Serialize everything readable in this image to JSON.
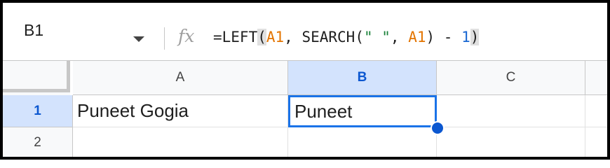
{
  "formula_bar": {
    "name_box": "B1",
    "fx_label": "fx",
    "formula": {
      "p1": "=LEFT",
      "p2": "(",
      "p3": "A1",
      "p4": ", SEARCH(",
      "p5": "\" \"",
      "p6": ", ",
      "p7": "A1",
      "p8": ") - ",
      "p9": "1",
      "p10": ")"
    }
  },
  "columns": [
    {
      "label": "A"
    },
    {
      "label": "B",
      "selected": true
    },
    {
      "label": "C"
    }
  ],
  "rows": [
    {
      "label": "1",
      "selected": true,
      "cells": [
        "Puneet Gogia",
        "Puneet",
        ""
      ]
    },
    {
      "label": "2",
      "cells": [
        "",
        "",
        ""
      ]
    }
  ],
  "colors": {
    "selection_blue": "#1a73e8",
    "header_selected_bg": "#d3e3fd",
    "reference_orange": "#e37400",
    "string_green": "#188038",
    "number_blue": "#1967d2"
  }
}
